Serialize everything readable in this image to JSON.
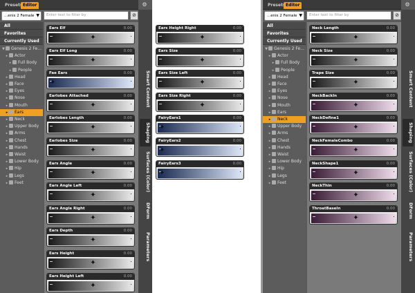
{
  "left_panel": {
    "tabs": [
      "Presets",
      "Editor"
    ],
    "figure_select": "...enis 2 Female",
    "filter_placeholder": "Enter text to filter by",
    "categories": [
      "All",
      "Favorites",
      "Currently Used"
    ],
    "tree": [
      {
        "label": "Genesis 2 Fe...",
        "depth": 0,
        "sel": false
      },
      {
        "label": "Actor",
        "depth": 1,
        "sel": false
      },
      {
        "label": "Full Body",
        "depth": 2,
        "sel": false
      },
      {
        "label": "People",
        "depth": 2,
        "sel": false
      },
      {
        "label": "Head",
        "depth": 1,
        "sel": false
      },
      {
        "label": "Face",
        "depth": 1,
        "sel": false
      },
      {
        "label": "Eyes",
        "depth": 1,
        "sel": false
      },
      {
        "label": "Nose",
        "depth": 1,
        "sel": false
      },
      {
        "label": "Mouth",
        "depth": 1,
        "sel": false
      },
      {
        "label": "Ears",
        "depth": 1,
        "sel": true
      },
      {
        "label": "Neck",
        "depth": 1,
        "sel": false
      },
      {
        "label": "Upper Body",
        "depth": 1,
        "sel": false
      },
      {
        "label": "Arms",
        "depth": 1,
        "sel": false
      },
      {
        "label": "Chest",
        "depth": 1,
        "sel": false
      },
      {
        "label": "Hands",
        "depth": 1,
        "sel": false
      },
      {
        "label": "Waist",
        "depth": 1,
        "sel": false
      },
      {
        "label": "Lower Body",
        "depth": 1,
        "sel": false
      },
      {
        "label": "Hip",
        "depth": 1,
        "sel": false
      },
      {
        "label": "Legs",
        "depth": 1,
        "sel": false
      },
      {
        "label": "Feet",
        "depth": 1,
        "sel": false
      }
    ],
    "sliders": [
      {
        "label": "Ears Elf",
        "value": "0.00",
        "color": "gray",
        "pos": 0.52
      },
      {
        "label": "Ears Elf Long",
        "value": "0.00",
        "color": "gray",
        "pos": 0.52
      },
      {
        "label": "Fae Ears",
        "value": "0.00",
        "color": "blue",
        "pos": 0.05
      },
      {
        "label": "Earlobes Attached",
        "value": "0.00",
        "color": "gray",
        "pos": 0.52
      },
      {
        "label": "Earlobes Length",
        "value": "0.00",
        "color": "gray",
        "pos": 0.52
      },
      {
        "label": "Earlobes Size",
        "value": "0.00",
        "color": "gray",
        "pos": 0.52
      },
      {
        "label": "Ears Angle",
        "value": "0.00",
        "color": "gray",
        "pos": 0.52
      },
      {
        "label": "Ears Angle Left",
        "value": "0.00",
        "color": "gray",
        "pos": 0.52
      },
      {
        "label": "Ears Angle Right",
        "value": "0.00",
        "color": "gray",
        "pos": 0.52
      },
      {
        "label": "Ears Depth",
        "value": "0.00",
        "color": "gray",
        "pos": 0.52
      },
      {
        "label": "Ears Height",
        "value": "0.00",
        "color": "gray",
        "pos": 0.52
      },
      {
        "label": "Ears Height Left",
        "value": "0.00",
        "color": "gray",
        "pos": 0.52
      }
    ],
    "vtabs": [
      "Smart Content",
      "Shaping",
      "Surfaces (Color)",
      "DForm",
      "Parameters"
    ],
    "active_vtab": "Shaping"
  },
  "mid_panel": {
    "sliders": [
      {
        "label": "Ears Height Right",
        "value": "0.00",
        "color": "gray",
        "pos": 0.52
      },
      {
        "label": "Ears Size",
        "value": "0.00",
        "color": "gray",
        "pos": 0.52
      },
      {
        "label": "Ears Size Left",
        "value": "0.00",
        "color": "gray",
        "pos": 0.52
      },
      {
        "label": "Ears Size Right",
        "value": "0.00",
        "color": "gray",
        "pos": 0.52
      },
      {
        "label": "FairyEars1",
        "value": "0.00",
        "color": "blue",
        "pos": 0.05
      },
      {
        "label": "FairyEars2",
        "value": "0.00",
        "color": "blue",
        "pos": 0.05
      },
      {
        "label": "FairyEars3",
        "value": "0.00",
        "color": "blue",
        "pos": 0.05
      }
    ]
  },
  "right_panel": {
    "tabs": [
      "Presets",
      "Editor"
    ],
    "figure_select": "...enis 2 Female",
    "filter_placeholder": "Enter text to filter by",
    "categories": [
      "All",
      "Favorites",
      "Currently Used"
    ],
    "tree": [
      {
        "label": "Genesis 2 Fe...",
        "depth": 0,
        "sel": false
      },
      {
        "label": "Actor",
        "depth": 1,
        "sel": false
      },
      {
        "label": "Full Body",
        "depth": 2,
        "sel": false
      },
      {
        "label": "People",
        "depth": 2,
        "sel": false
      },
      {
        "label": "Head",
        "depth": 1,
        "sel": false
      },
      {
        "label": "Face",
        "depth": 1,
        "sel": false
      },
      {
        "label": "Eyes",
        "depth": 1,
        "sel": false
      },
      {
        "label": "Nose",
        "depth": 1,
        "sel": false
      },
      {
        "label": "Mouth",
        "depth": 1,
        "sel": false
      },
      {
        "label": "Ears",
        "depth": 1,
        "sel": false
      },
      {
        "label": "Neck",
        "depth": 1,
        "sel": true
      },
      {
        "label": "Upper Body",
        "depth": 1,
        "sel": false
      },
      {
        "label": "Arms",
        "depth": 1,
        "sel": false
      },
      {
        "label": "Chest",
        "depth": 1,
        "sel": false
      },
      {
        "label": "Hands",
        "depth": 1,
        "sel": false
      },
      {
        "label": "Waist",
        "depth": 1,
        "sel": false
      },
      {
        "label": "Lower Body",
        "depth": 1,
        "sel": false
      },
      {
        "label": "Hip",
        "depth": 1,
        "sel": false
      },
      {
        "label": "Legs",
        "depth": 1,
        "sel": false
      },
      {
        "label": "Feet",
        "depth": 1,
        "sel": false
      }
    ],
    "sliders": [
      {
        "label": "Neck Length",
        "value": "0.00",
        "color": "gray",
        "pos": 0.52
      },
      {
        "label": "Neck Size",
        "value": "0.00",
        "color": "gray",
        "pos": 0.52
      },
      {
        "label": "Trape Size",
        "value": "0.00",
        "color": "gray",
        "pos": 0.52
      },
      {
        "label": "NeckBackIn",
        "value": "0.00",
        "color": "pink",
        "pos": 0.52
      },
      {
        "label": "NeckDefine1",
        "value": "0.00",
        "color": "pink",
        "pos": 0.52
      },
      {
        "label": "NeckFemaleCombo",
        "value": "0.00",
        "color": "pink",
        "pos": 0.52
      },
      {
        "label": "NeckShape1",
        "value": "0.00",
        "color": "pink",
        "pos": 0.52
      },
      {
        "label": "NeckThin",
        "value": "0.00",
        "color": "pink",
        "pos": 0.52
      },
      {
        "label": "ThroatBaseIn",
        "value": "0.00",
        "color": "pink",
        "pos": 0.52
      }
    ],
    "vtabs": [
      "Smart Content",
      "Shaping",
      "Surfaces (Color)",
      "DForm",
      "Parameters"
    ],
    "active_vtab": "Shaping"
  },
  "icons": {
    "settings": "gear-icon",
    "filter_clear": "clear-icon",
    "slider_knob": "knob-icon",
    "tree_expand": "triangle-icon",
    "tree_node": "figure-icon"
  }
}
